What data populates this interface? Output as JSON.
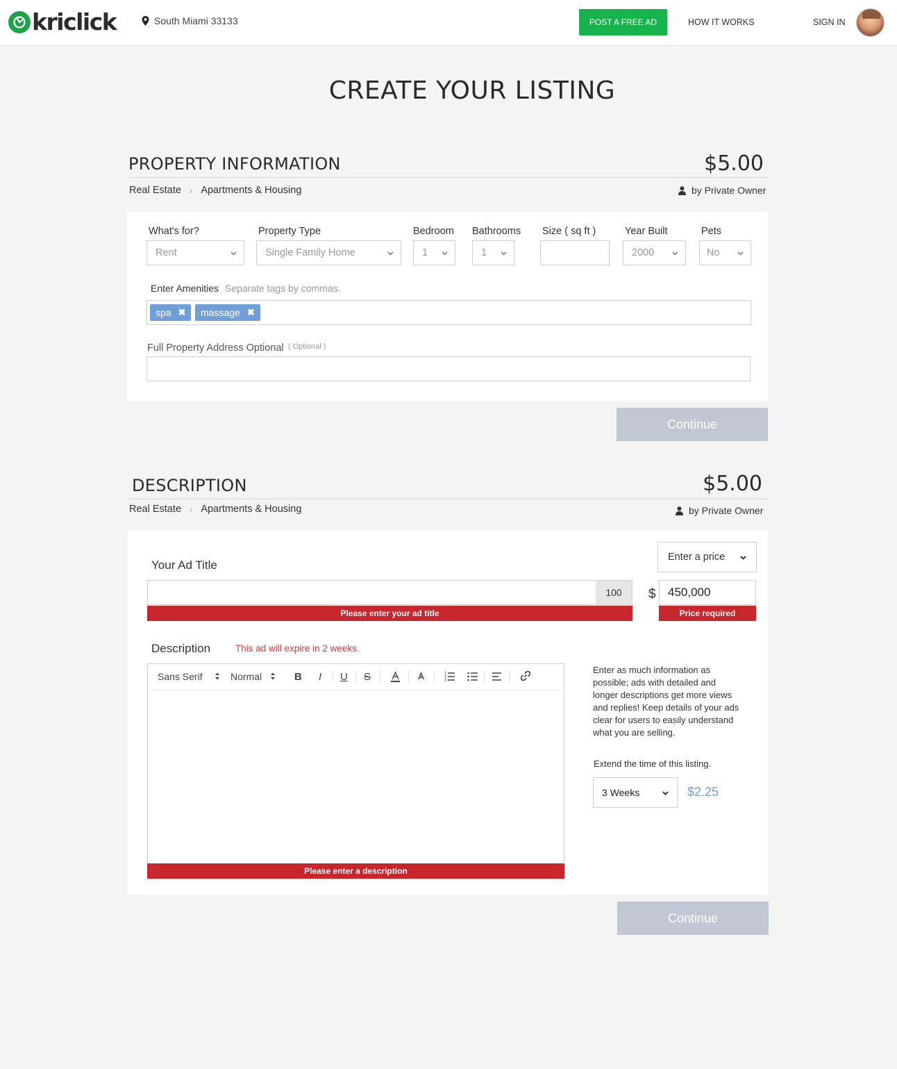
{
  "header": {
    "logo_text": "kriclick",
    "location": "South Miami 33133",
    "post_ad": "POST A FREE AD",
    "how_it_works": "HOW IT WORKS",
    "sign_in": "SIGN IN"
  },
  "page_title": "CREATE YOUR LISTING",
  "property": {
    "title": "PROPERTY INFORMATION",
    "price": "$5.00",
    "crumb1": "Real Estate",
    "crumb2": "Apartments & Housing",
    "crumb_sep": "›",
    "owner": "by Private Owner",
    "fields": {
      "whats_for_label": "What's for?",
      "whats_for_value": "Rent",
      "type_label": "Property Type",
      "type_value": "Single Family Home",
      "bedroom_label": "Bedroom",
      "bedroom_value": "1",
      "bathrooms_label": "Bathrooms",
      "bathrooms_value": "1",
      "size_label": "Size ( sq ft )",
      "year_label": "Year Built",
      "year_value": "2000",
      "pets_label": "Pets",
      "pets_value": "No"
    },
    "amenities_label": "Enter Amenities",
    "amenities_hint": "Separate tags by commas.",
    "tags": [
      "spa",
      "massage"
    ],
    "tag_remove": "✖",
    "address_label": "Full Property Address Optional",
    "address_optional": "( Optional )",
    "continue": "Continue"
  },
  "description": {
    "title": "DESCRIPTION",
    "price": "$5.00",
    "crumb1": "Real Estate",
    "crumb2": "Apartments & Housing",
    "crumb_sep": "›",
    "owner": "by Private Owner",
    "price_mode": "Enter a price",
    "ad_title_label": "Your Ad Title",
    "char_count": "100",
    "ad_title_error": "Please enter your ad title",
    "currency": "$",
    "price_value": "450,000",
    "price_error": "Price required",
    "desc_label": "Description",
    "expire_note": "This ad will expire in 2 weeks.",
    "toolbar": {
      "font": "Sans Serif",
      "size": "Normal",
      "bold": "B",
      "italic": "I",
      "underline": "U",
      "strike": "S"
    },
    "desc_error": "Please enter a description",
    "help_text": "Enter as much information as possible; ads with detailed and longer descriptions get more views and replies!  Keep details of your ads clear for users to easily understand  what you are selling.",
    "extend_label": "Extend the time of this listing.",
    "extend_value": "3 Weeks",
    "extend_price": "$2.25",
    "continue": "Continue"
  },
  "colors": {
    "brand_green": "#16b24b",
    "error_red": "#c8262d",
    "tag_blue": "#6f9fd6",
    "price_blue": "#6f9fd6",
    "continue_disabled": "#c0c6d2"
  },
  "icons": [
    "logo-icon",
    "map-pin-icon",
    "user-icon",
    "chevron-down-icon",
    "close-icon",
    "bold-icon",
    "italic-icon",
    "underline-icon",
    "strike-icon",
    "text-color-icon",
    "highlight-icon",
    "ordered-list-icon",
    "bullet-list-icon",
    "align-icon",
    "link-icon"
  ]
}
